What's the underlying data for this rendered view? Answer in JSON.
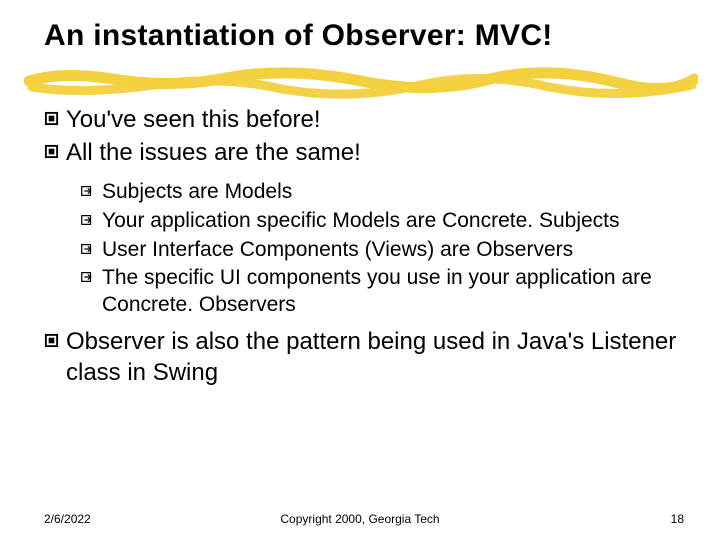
{
  "title": "An instantiation of Observer: MVC!",
  "bullets": {
    "b1": "You've seen this before!",
    "b2": "All the issues are the same!",
    "s1": "Subjects are Models",
    "s2": "Your application specific Models are Concrete. Subjects",
    "s3": "User Interface Components (Views) are Observers",
    "s4": "The specific UI components you use in your application are Concrete. Observers",
    "b3": "Observer is also the pattern being used in Java's Listener class in Swing"
  },
  "footer": {
    "date": "2/6/2022",
    "copyright": "Copyright 2000, Georgia Tech",
    "page": "18"
  },
  "colors": {
    "underline": "#f3d03e"
  }
}
